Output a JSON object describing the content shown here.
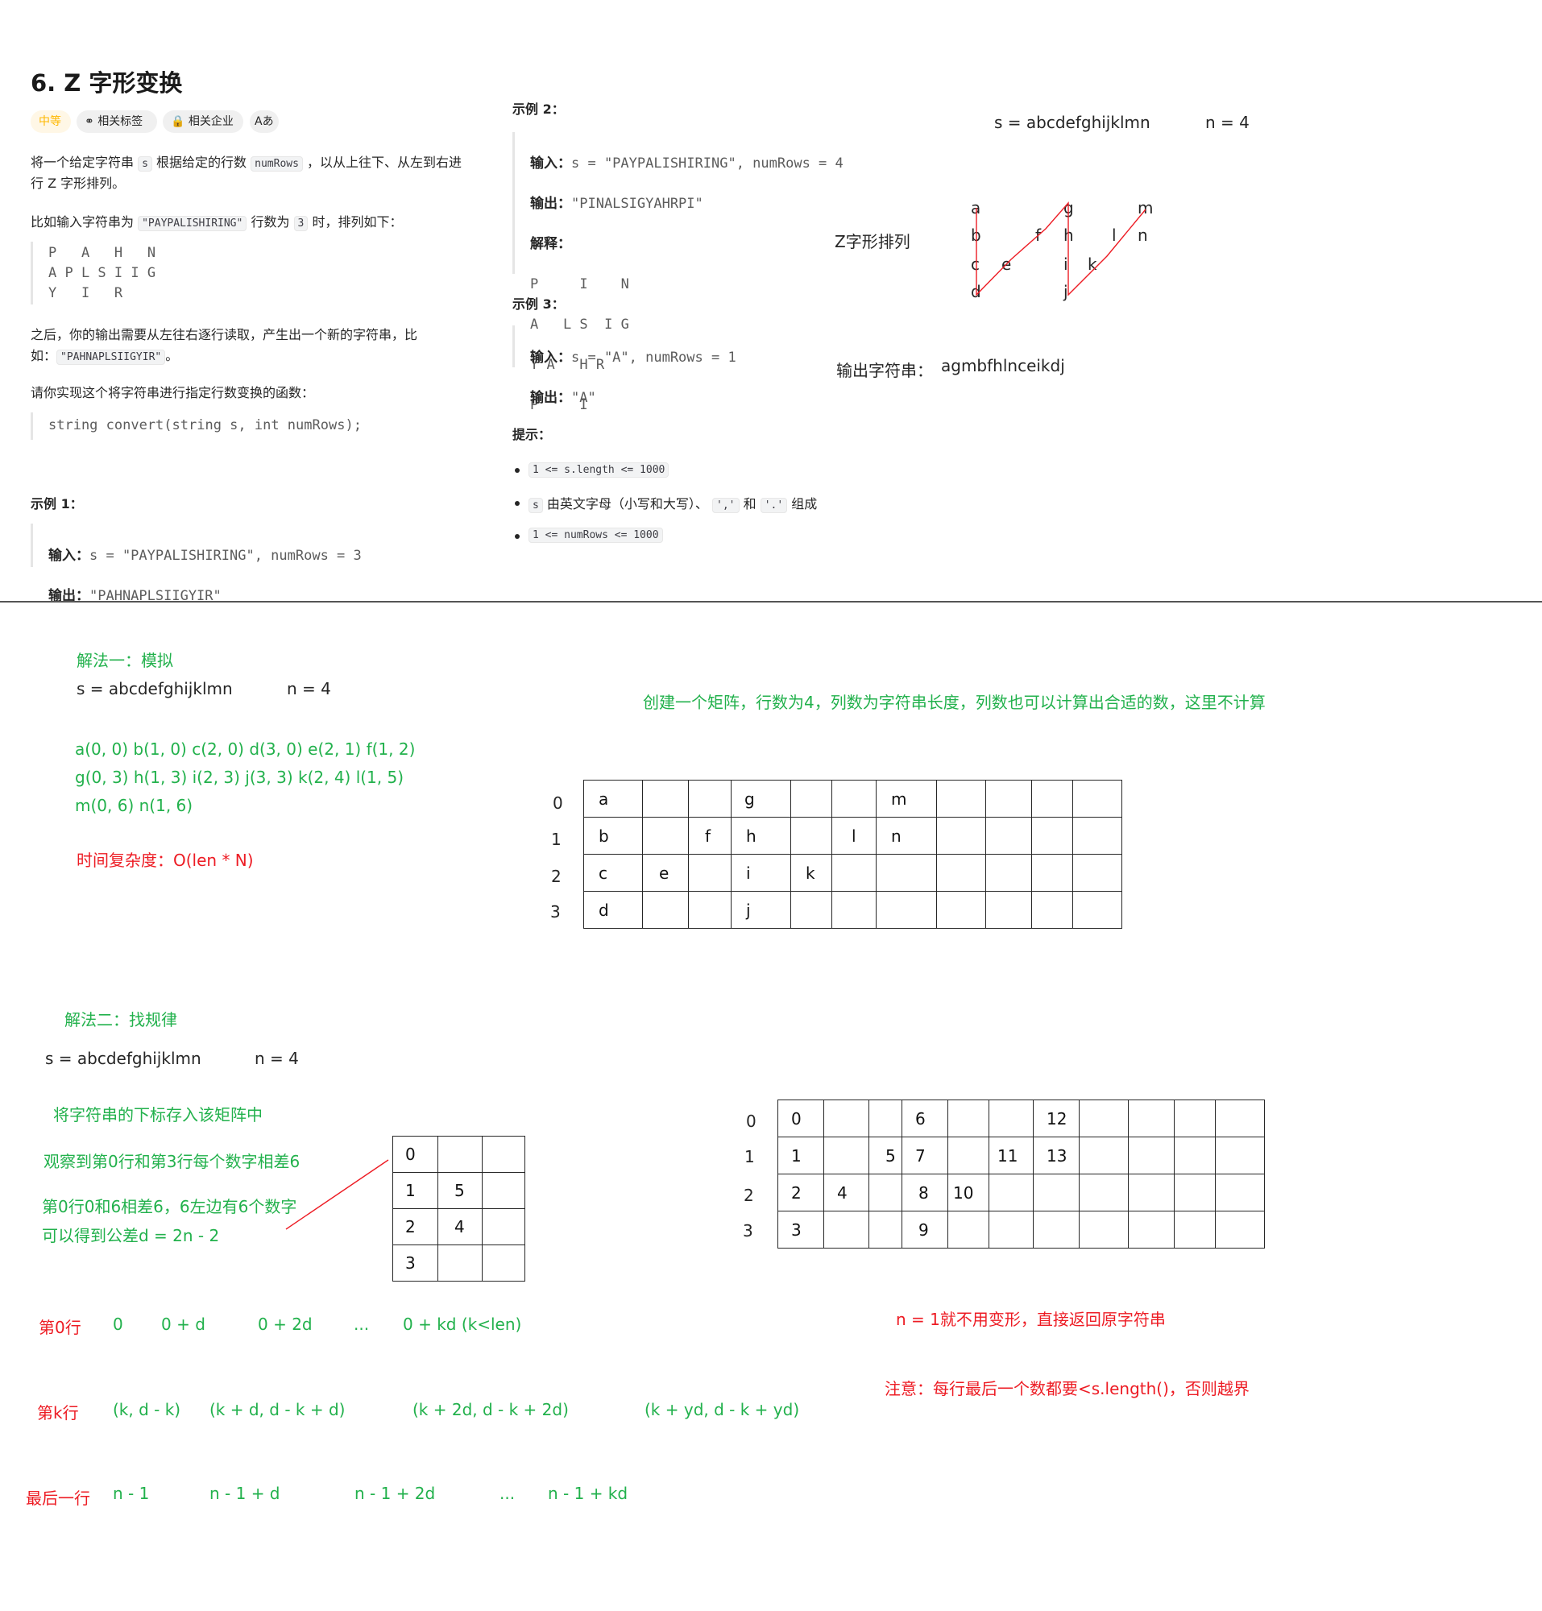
{
  "problem": {
    "title": "6. Z 字形变换",
    "tags": [
      "中等",
      "相关标签",
      "相关企业",
      "Aあ"
    ],
    "desc1a": "将一个给定字符串",
    "desc1_code_s": "s",
    "desc1b": "根据给定的行数",
    "desc1_code_rows": "numRows",
    "desc1c": "，以从上往下、从左到右进",
    "desc1d": "行 Z 字形排列。",
    "desc2a": "比如输入字符串为",
    "desc2_code": "\"PAYPALISHIRING\"",
    "desc2b": "行数为",
    "desc2_code_n": "3",
    "desc2c": "时，排列如下：",
    "zigzag": [
      "P   A   H   N",
      "A P L S I I G",
      "Y   I   R"
    ],
    "desc3a": "之后，你的输出需要从左往右逐行读取，产生出一个新的字符串，比",
    "desc3b": "如：",
    "desc3_code": "\"PAHNAPLSIIGYIR\"",
    "desc3c": "。",
    "desc4": "请你实现这个将字符串进行指定行数变换的函数：",
    "signature": "string convert(string s, int numRows);"
  },
  "examples": {
    "ex1_title": "示例 1：",
    "ex1_in_label": "输入：",
    "ex1_in": "s = \"PAYPALISHIRING\", numRows = 3",
    "ex1_out_label": "输出：",
    "ex1_out": "\"PAHNAPLSIIGYIR\"",
    "ex2_title": "示例 2：",
    "ex2_in_label": "输入：",
    "ex2_in": "s = \"PAYPALISHIRING\", numRows = 4",
    "ex2_out_label": "输出：",
    "ex2_out": "\"PINALSIGYAHRPI\"",
    "ex2_exp_label": "解释：",
    "ex2_exp": [
      "P     I    N",
      "A   L S  I G",
      "Y A   H R",
      "P     I"
    ],
    "ex3_title": "示例 3：",
    "ex3_in_label": "输入：",
    "ex3_in": "s = \"A\", numRows = 1",
    "ex3_out_label": "输出：",
    "ex3_out": "\"A\"",
    "hint_title": "提示：",
    "hint1": "1 <= s.length <= 1000",
    "hint2_code": "s",
    "hint2_text": "由英文字母（小写和大写）、",
    "hint2_comma": "','",
    "hint2_and": "和",
    "hint2_dot": "'.'",
    "hint2_end": "组成",
    "hint3": "1 <= numRows <= 1000"
  },
  "sketch": {
    "s": "s = abcdefghijklmn",
    "n": "n = 4",
    "z_label": "Z字形排列",
    "output_label": "输出字符串：",
    "output_value": "agmbfhlnceikdj"
  },
  "method1": {
    "title": "解法一：模拟",
    "s": "s = abcdefghijklmn",
    "n": "n = 4",
    "coords1": "a(0, 0) b(1, 0) c(2, 0) d(3, 0) e(2, 1) f(1, 2)",
    "coords2": "g(0, 3) h(1, 3) i(2, 3) j(3, 3) k(2, 4) l(1, 5)",
    "coords3": "m(0, 6) n(1, 6)",
    "complexity": "时间复杂度：O(len * N)",
    "note": "创建一个矩阵，行数为4，列数为字符串长度，列数也可以计算出合适的数，这里不计算",
    "row_labels": [
      "0",
      "1",
      "2",
      "3"
    ]
  },
  "method2": {
    "title": "解法二：找规律",
    "s": "s = abcdefghijklmn",
    "n": "n = 4",
    "store_note": "将字符串的下标存入该矩阵中",
    "obs1": "观察到第0行和第3行每个数字相差6",
    "obs2": "第0行0和6相差6，6左边有6个数字",
    "obs3": "可以得到公差d = 2n - 2",
    "row_labels": [
      "0",
      "1",
      "2",
      "3"
    ],
    "n1_note": "n = 1就不用变形，直接返回原字符串",
    "bound_note": "注意：每行最后一个数都要<s.length()，否则越界",
    "row0": [
      "第0行",
      "0",
      "0 + d",
      "0 + 2d",
      "...",
      "0 + kd (k<len)"
    ],
    "rowk": [
      "第k行",
      "(k, d - k)",
      "(k + d, d - k + d)",
      "(k + 2d, d - k + 2d)",
      "(k + yd, d - k + yd)"
    ],
    "rowlast": [
      "最后一行",
      "n - 1",
      "n - 1 + d",
      "n - 1 + 2d",
      "...",
      "n - 1 + kd"
    ]
  },
  "colors": {
    "green": "#22b14c",
    "red": "#ed1c24",
    "difficulty": "#ffb800"
  }
}
